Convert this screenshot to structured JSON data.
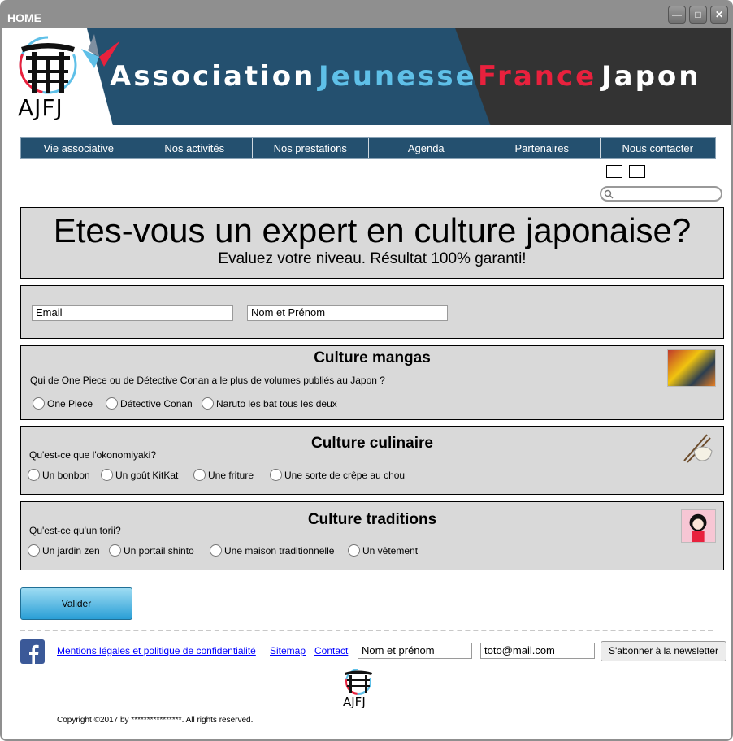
{
  "window": {
    "title": "HOME"
  },
  "banner": {
    "logo_text": "AJFJ",
    "word1": "Association",
    "word2": "Jeunesse",
    "word3": "France",
    "word4": "Japon"
  },
  "nav": {
    "items": [
      "Vie associative",
      "Nos activités",
      "Nos prestations",
      "Agenda",
      "Partenaires",
      "Nous contacter"
    ]
  },
  "hero": {
    "title": "Etes-vous un expert en culture japonaise?",
    "subtitle": "Evaluez votre niveau. Résultat 100% garanti!"
  },
  "form": {
    "email_placeholder": "Email",
    "name_placeholder": "Nom et Prénom"
  },
  "quiz": [
    {
      "title": "Culture mangas",
      "question": "Qui de One Piece ou de Détective Conan a le plus de volumes publiés au Japon ?",
      "options": [
        "One Piece",
        "Détective Conan",
        "Naruto les bat tous les deux"
      ]
    },
    {
      "title": "Culture culinaire",
      "question": "Qu'est-ce que l'okonomiyaki?",
      "options": [
        "Un bonbon",
        "Un goût KitKat",
        "Une friture",
        "Une sorte de crêpe au chou"
      ]
    },
    {
      "title": "Culture traditions",
      "question": "Qu'est-ce qu'un torii?",
      "options": [
        "Un jardin zen",
        "Un portail shinto",
        "Une maison traditionnelle",
        "Un vêtement"
      ]
    }
  ],
  "submit_label": "Valider",
  "footer": {
    "links": [
      "Mentions légales et politique de confidentialité",
      "Sitemap",
      "Contact"
    ],
    "newsletter_name_placeholder": "Nom et prénom",
    "newsletter_email_value": "toto@mail.com",
    "subscribe_label": "S'abonner à la newsletter",
    "logo_text": "AJFJ",
    "copyright": "Copyright ©2017 by ****************. All rights reserved."
  },
  "colors": {
    "nav_bg": "#24506f",
    "brand_red": "#e8213d",
    "brand_blue": "#5fc0e8",
    "button_blue": "#2a9fd6"
  }
}
